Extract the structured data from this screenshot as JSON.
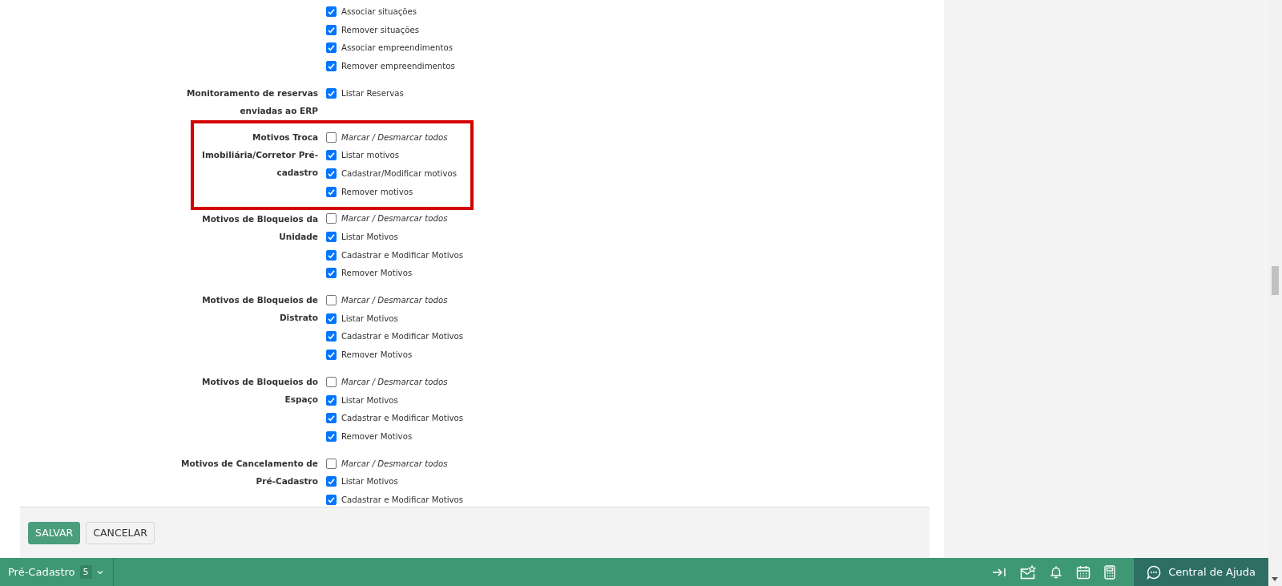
{
  "groups": [
    {
      "highlighted": false,
      "items": [
        {
          "kind": "permission",
          "text": "Associar situações",
          "checked": true
        },
        {
          "kind": "permission",
          "text": "Remover situações",
          "checked": true
        },
        {
          "kind": "permission",
          "text": "Associar empreendimentos",
          "checked": true
        },
        {
          "kind": "permission",
          "text": "Remover empreendimentos",
          "checked": true
        }
      ]
    },
    {
      "label": "Monitoramento de reservas enviadas ao ERP",
      "highlighted": false,
      "items": [
        {
          "kind": "permission",
          "text": "Listar Reservas",
          "checked": true
        }
      ]
    },
    {
      "label": "Motivos Troca Imobiliária/Corretor Pré-cadastro",
      "highlighted": true,
      "items": [
        {
          "kind": "toggle-all",
          "text": "Marcar / Desmarcar todos",
          "checked": false
        },
        {
          "kind": "permission",
          "text": "Listar motivos",
          "checked": true
        },
        {
          "kind": "permission",
          "text": "Cadastrar/Modificar motivos",
          "checked": true
        },
        {
          "kind": "permission",
          "text": "Remover motivos",
          "checked": true
        }
      ]
    },
    {
      "label": "Motivos de Bloqueios da Unidade",
      "highlighted": false,
      "items": [
        {
          "kind": "toggle-all",
          "text": "Marcar / Desmarcar todos",
          "checked": false
        },
        {
          "kind": "permission",
          "text": "Listar Motivos",
          "checked": true
        },
        {
          "kind": "permission",
          "text": "Cadastrar e Modificar Motivos",
          "checked": true
        },
        {
          "kind": "permission",
          "text": "Remover Motivos",
          "checked": true
        }
      ]
    },
    {
      "label": "Motivos de Bloqueios de Distrato",
      "highlighted": false,
      "items": [
        {
          "kind": "toggle-all",
          "text": "Marcar / Desmarcar todos",
          "checked": false
        },
        {
          "kind": "permission",
          "text": "Listar Motivos",
          "checked": true
        },
        {
          "kind": "permission",
          "text": "Cadastrar e Modificar Motivos",
          "checked": true
        },
        {
          "kind": "permission",
          "text": "Remover Motivos",
          "checked": true
        }
      ]
    },
    {
      "label": "Motivos de Bloqueios do Espaço",
      "highlighted": false,
      "items": [
        {
          "kind": "toggle-all",
          "text": "Marcar / Desmarcar todos",
          "checked": false
        },
        {
          "kind": "permission",
          "text": "Listar Motivos",
          "checked": true
        },
        {
          "kind": "permission",
          "text": "Cadastrar e Modificar Motivos",
          "checked": true
        },
        {
          "kind": "permission",
          "text": "Remover Motivos",
          "checked": true
        }
      ]
    },
    {
      "label": "Motivos de Cancelamento de Pré-Cadastro",
      "highlighted": false,
      "items": [
        {
          "kind": "toggle-all",
          "text": "Marcar / Desmarcar todos",
          "checked": false
        },
        {
          "kind": "permission",
          "text": "Listar Motivos",
          "checked": true
        },
        {
          "kind": "permission",
          "text": "Cadastrar e Modificar Motivos",
          "checked": true
        }
      ]
    }
  ],
  "buttons": [
    {
      "label": "SALVAR",
      "kind": "primary"
    },
    {
      "label": "CANCELAR",
      "kind": "secondary"
    }
  ],
  "bottom_bar": {
    "module": {
      "label": "Pré-Cadastro",
      "count": "5"
    },
    "help": {
      "label": "Central de Ajuda"
    }
  }
}
